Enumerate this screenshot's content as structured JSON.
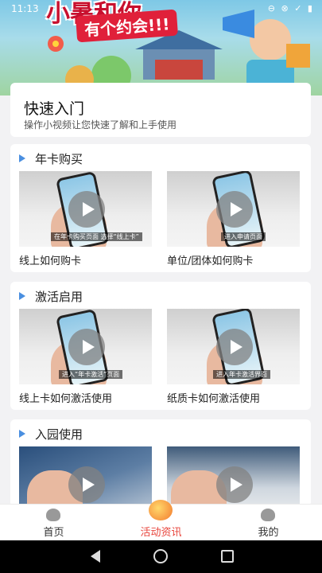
{
  "status": {
    "time": "11:13",
    "icons": "⊖ ⊗ ✓ ▮"
  },
  "banner": {
    "title_line1": "小暑和你",
    "title_line2": "有个约会!!!"
  },
  "quick_start": {
    "title": "快速入门",
    "subtitle": "操作小视频让您快速了解和上手使用"
  },
  "sections": [
    {
      "title": "年卡购买",
      "videos": [
        {
          "caption": "线上如何购卡",
          "overlay": "在年卡购买页面 选择“线上卡”"
        },
        {
          "caption": "单位/团体如何购卡",
          "overlay": "进入申请页面"
        }
      ]
    },
    {
      "title": "激活启用",
      "videos": [
        {
          "caption": "线上卡如何激活使用",
          "overlay": "进入“年卡激活”页面"
        },
        {
          "caption": "纸质卡如何激活使用",
          "overlay": "进入年卡激活界面"
        }
      ]
    },
    {
      "title": "入园使用",
      "videos": [
        {
          "caption": "",
          "overlay": ""
        },
        {
          "caption": "",
          "overlay": ""
        }
      ]
    }
  ],
  "tabbar": {
    "items": [
      {
        "label": "首页",
        "icon": "home-face-icon",
        "active": false
      },
      {
        "label": "活动资讯",
        "icon": "activity-icon",
        "active": true
      },
      {
        "label": "我的",
        "icon": "profile-face-icon",
        "active": false
      }
    ]
  },
  "colors": {
    "accent": "#e8453c",
    "section_marker": "#4a8fe0"
  }
}
